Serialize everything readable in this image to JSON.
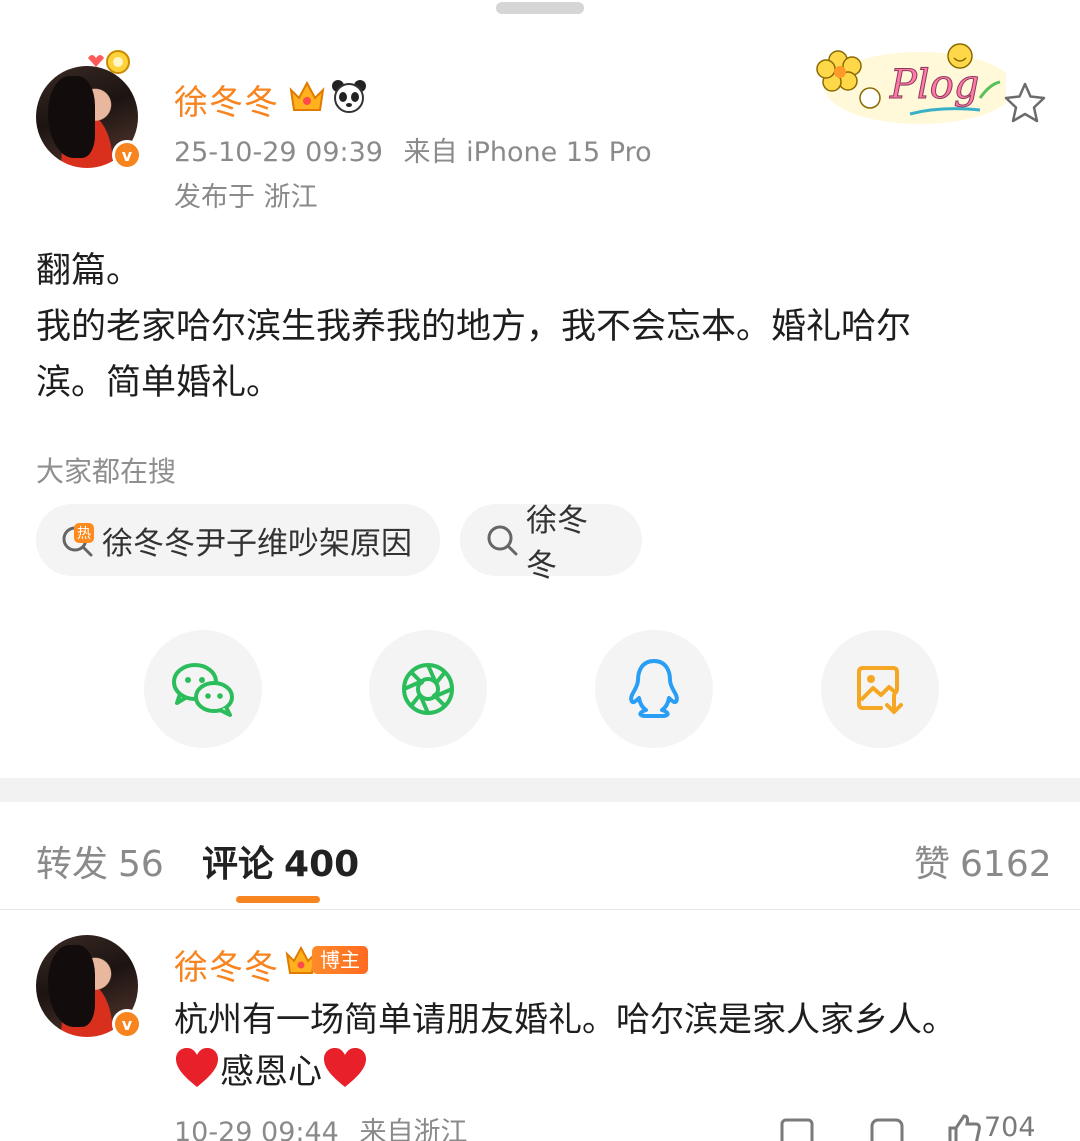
{
  "post": {
    "author": "徐冬冬",
    "time": "25-10-29 09:39",
    "source": "来自 iPhone 15 Pro",
    "location": "发布于 浙江",
    "content_lines": [
      "翻篇。",
      "我的老家哈尔滨生我养我的地方，我不会忘本。婚礼哈尔",
      "滨。简单婚礼。"
    ],
    "badge_text": "Plog"
  },
  "search": {
    "title": "大家都在搜",
    "chips": [
      {
        "label": "徐冬冬尹子维吵架原因",
        "icon": "hot-search-icon",
        "icon_text": "热"
      },
      {
        "label": "徐冬冬",
        "icon": "search-icon"
      }
    ]
  },
  "share": {
    "buttons": [
      {
        "icon": "wechat-icon",
        "color": "#2bbd5b"
      },
      {
        "icon": "moments-icon",
        "color": "#2bbd5b"
      },
      {
        "icon": "qq-icon",
        "color": "#2a9ef5"
      },
      {
        "icon": "save-image-icon",
        "color": "#f5a623"
      }
    ]
  },
  "tabs": {
    "repost": {
      "label": "转发",
      "count": "56"
    },
    "comments": {
      "label": "评论",
      "count": "400"
    },
    "likes": {
      "label": "赞",
      "count": "6162"
    }
  },
  "comment": {
    "author": "徐冬冬",
    "badge": "博主",
    "line1": "杭州有一场简单请朋友婚礼。哈尔滨是家人家乡人。",
    "line2": "感恩心",
    "time": "10-29 09:44",
    "source": "来自浙江",
    "like_count": "704"
  },
  "colors": {
    "accent": "#f7841f",
    "verified": "#f7841f"
  }
}
